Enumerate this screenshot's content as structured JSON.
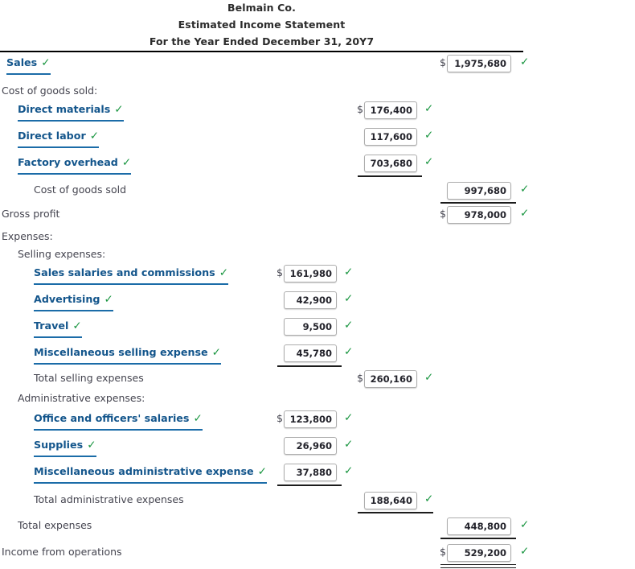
{
  "header": {
    "company": "Belmain Co.",
    "statement": "Estimated Income Statement",
    "period": "For the Year Ended December 31, 20Y7"
  },
  "icons": {
    "check": "✓",
    "dollar": "$"
  },
  "colors": {
    "link": "#14568c",
    "check_green": "#1a9641",
    "label_text": "#44444f",
    "rule": "#1c1c1c",
    "box_border": "#adadad"
  },
  "rows": [
    {
      "key": "sales",
      "label": "Sales",
      "value": "1,975,680"
    },
    {
      "key": "cogs_header",
      "label": "Cost of goods sold:",
      "value": ""
    },
    {
      "key": "direct_materials",
      "label": "Direct materials",
      "value": "176,400"
    },
    {
      "key": "direct_labor",
      "label": "Direct labor",
      "value": "117,600"
    },
    {
      "key": "factory_overhead",
      "label": "Factory overhead",
      "value": "703,680"
    },
    {
      "key": "cogs_total",
      "label": "Cost of goods sold",
      "value": "997,680"
    },
    {
      "key": "gross_profit",
      "label": "Gross profit",
      "value": "978,000"
    },
    {
      "key": "expenses_header",
      "label": "Expenses:",
      "value": ""
    },
    {
      "key": "selling_header",
      "label": "Selling expenses:",
      "value": ""
    },
    {
      "key": "sales_salaries",
      "label": "Sales salaries and commissions",
      "value": "161,980"
    },
    {
      "key": "advertising",
      "label": "Advertising",
      "value": "42,900"
    },
    {
      "key": "travel",
      "label": "Travel",
      "value": "9,500"
    },
    {
      "key": "misc_selling",
      "label": "Miscellaneous selling expense",
      "value": "45,780"
    },
    {
      "key": "total_selling",
      "label": "Total selling expenses",
      "value": "260,160"
    },
    {
      "key": "admin_header",
      "label": "Administrative expenses:",
      "value": ""
    },
    {
      "key": "office_salaries",
      "label": "Office and officers' salaries",
      "value": "123,800"
    },
    {
      "key": "supplies",
      "label": "Supplies",
      "value": "26,960"
    },
    {
      "key": "misc_admin",
      "label": "Miscellaneous administrative expense",
      "value": "37,880"
    },
    {
      "key": "total_admin",
      "label": "Total administrative expenses",
      "value": "188,640"
    },
    {
      "key": "total_expenses",
      "label": "Total expenses",
      "value": "448,800"
    },
    {
      "key": "income_ops",
      "label": "Income from operations",
      "value": "529,200"
    }
  ]
}
